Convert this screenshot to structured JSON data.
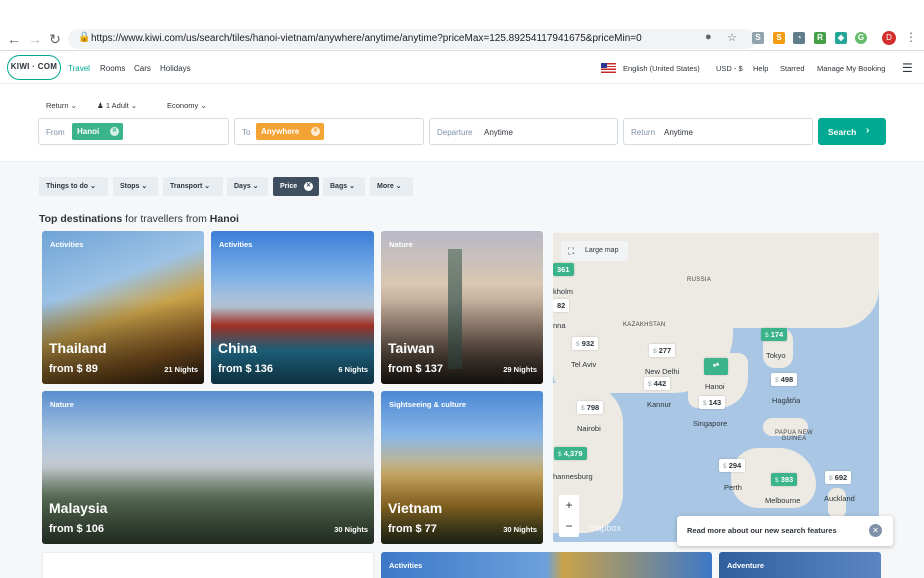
{
  "browser": {
    "url": "https://www.kiwi.com/us/search/tiles/hanoi-vietnam/anywhere/anytime/anytime?priceMax=125.89254117941675&priceMin=0",
    "profile_initial": "D"
  },
  "header": {
    "logo": "KIWI · COM",
    "nav": [
      "Travel",
      "Rooms",
      "Cars",
      "Holidays"
    ],
    "language": "English (United States)",
    "currency": "USD - $",
    "help": "Help",
    "starred": "Starred",
    "manage": "Manage My Booking"
  },
  "search": {
    "trip_type": "Return",
    "passengers": "1 Adult",
    "cabin": "Economy",
    "from_label": "From",
    "from_value": "Hanoi",
    "to_label": "To",
    "to_value": "Anywhere",
    "departure_label": "Departure",
    "departure_value": "Anytime",
    "return_label": "Return",
    "return_value": "Anytime",
    "search_button": "Search"
  },
  "filters": [
    {
      "label": "Things to do",
      "active": false
    },
    {
      "label": "Stops",
      "active": false
    },
    {
      "label": "Transport",
      "active": false
    },
    {
      "label": "Days",
      "active": false
    },
    {
      "label": "Price",
      "active": true
    },
    {
      "label": "Bags",
      "active": false
    },
    {
      "label": "More",
      "active": false
    }
  ],
  "section": {
    "title_strong": "Top destinations",
    "title_mid": "for travellers from",
    "title_city": "Hanoi"
  },
  "tiles": [
    {
      "tag": "Activities",
      "name": "Thailand",
      "price": "from $ 89",
      "nights": "21 Nights"
    },
    {
      "tag": "Activities",
      "name": "China",
      "price": "from $ 136",
      "nights": "6 Nights"
    },
    {
      "tag": "Nature",
      "name": "Taiwan",
      "price": "from $ 137",
      "nights": "29 Nights"
    },
    {
      "tag": "Nature",
      "name": "Malaysia",
      "price": "from $ 106",
      "nights": "30 Nights"
    },
    {
      "tag": "Sightseeing & culture",
      "name": "Vietnam",
      "price": "from $ 77",
      "nights": "30 Nights"
    },
    {
      "tag": "Activities"
    },
    {
      "tag": "Adventure"
    }
  ],
  "map": {
    "large_map": "Large map",
    "regions": [
      "RUSSIA",
      "KAZAKHSTAN",
      "PAPUA NEW GUINEA"
    ],
    "partial_labels": [
      "kholm",
      "nna",
      "hannesburg",
      "mapbox"
    ],
    "prices": [
      "361",
      "82",
      "932",
      "277",
      "442",
      "798",
      "143",
      "174",
      "498",
      "4,379",
      "294",
      "393",
      "692"
    ],
    "cities": [
      "Tel Aviv",
      "New Delhi",
      "Kannur",
      "Hanoi",
      "Singapore",
      "Nairobi",
      "Tokyo",
      "Hagåtña",
      "Perth",
      "Melbourne",
      "Auckland"
    ],
    "zoom_in": "+",
    "zoom_out": "−"
  },
  "toast": {
    "text": "Read more about our new search features"
  },
  "colors": {
    "brand": "#00a991",
    "chip_from": "#3bb38b",
    "chip_to": "#f3a333",
    "active_filter": "#3f4f5f"
  }
}
